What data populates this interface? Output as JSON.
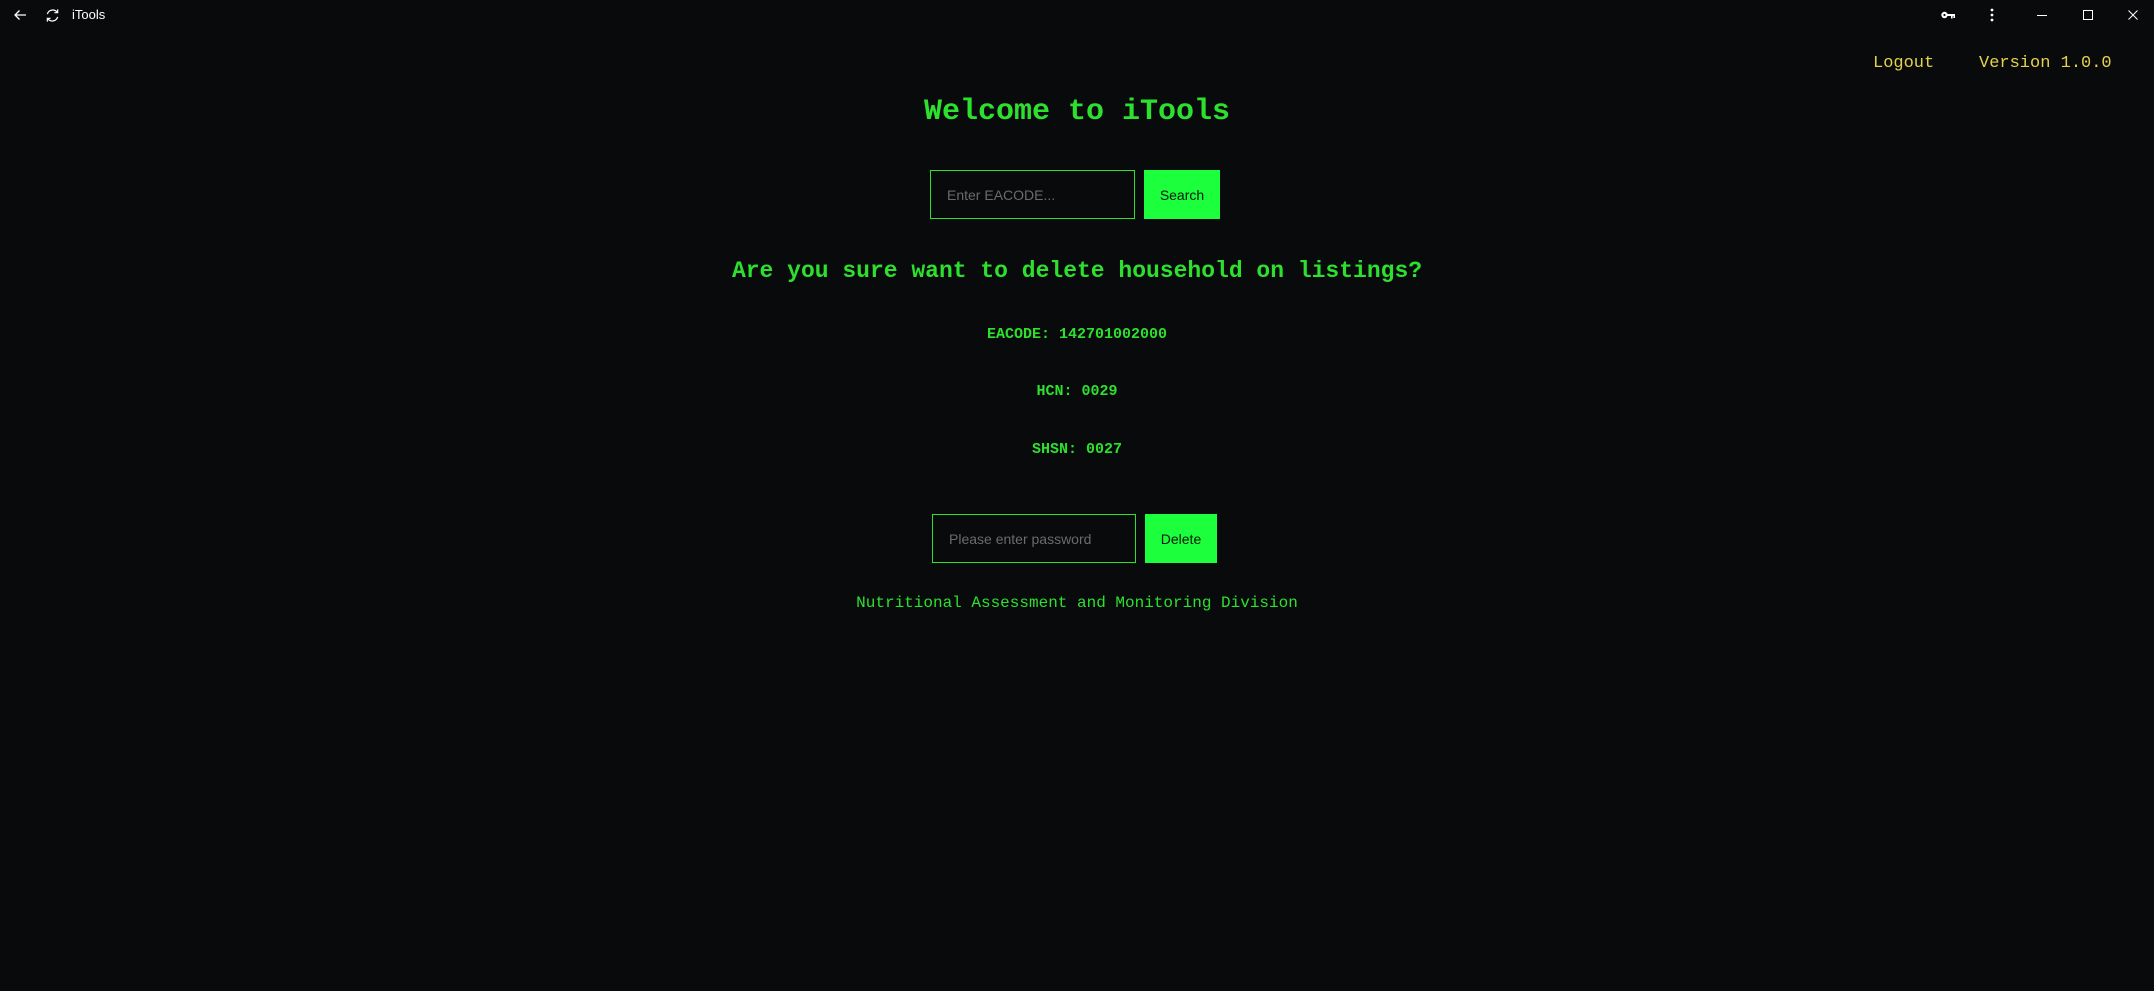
{
  "window": {
    "title": "iTools",
    "icons": {
      "back": "back-arrow-icon",
      "refresh": "refresh-icon",
      "key": "key-icon",
      "more": "more-vertical-icon",
      "minimize": "minimize-icon",
      "maximize": "maximize-icon",
      "close": "close-icon"
    }
  },
  "header": {
    "logout_label": "Logout",
    "version_label": "Version 1.0.0"
  },
  "main": {
    "welcome_title": "Welcome to iTools",
    "search": {
      "placeholder": "Enter EACODE...",
      "value": "",
      "button_label": "Search"
    },
    "confirm_title": "Are you sure want to delete household on listings?",
    "details": {
      "eacode": "EACODE: 142701002000",
      "hcn": "HCN: 0029",
      "shsn": "SHSN: 0027"
    },
    "delete_form": {
      "password_placeholder": "Please enter password",
      "password_value": "",
      "button_label": "Delete"
    },
    "footer": "Nutritional Assessment and Monitoring Division"
  },
  "colors": {
    "background": "#080a0c",
    "accent_green": "#2ee02e",
    "button_green": "#1cff3c",
    "link_yellow": "#e6d24a",
    "titlebar_text": "#ffffff"
  }
}
